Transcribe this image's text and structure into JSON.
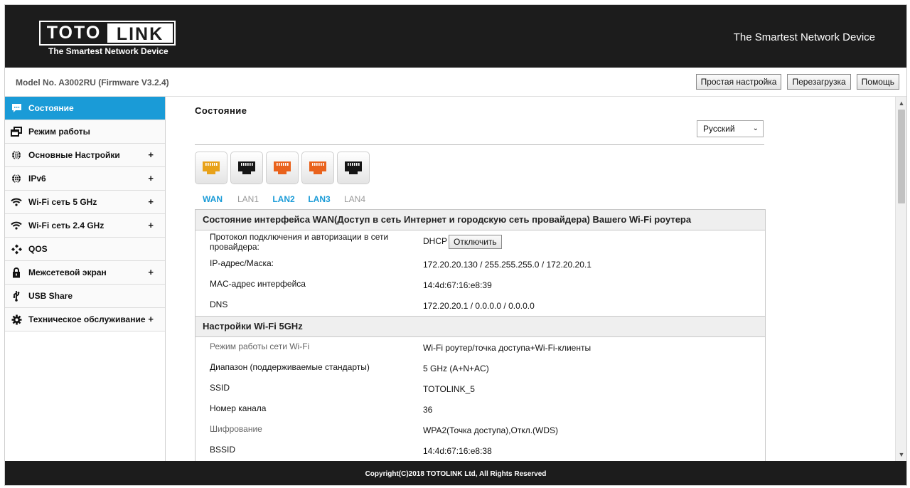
{
  "header": {
    "logo_left": "TOTO",
    "logo_right": "LINK",
    "logo_tagline": "The Smartest Network Device",
    "slogan": "The Smartest Network Device"
  },
  "subbar": {
    "model": "Model No. A3002RU (Firmware V3.2.4)",
    "buttons": [
      "Простая настройка",
      "Перезагрузка",
      "Помощь"
    ]
  },
  "sidebar": {
    "items": [
      {
        "label": "Состояние",
        "icon": "chat-icon",
        "expandable": false,
        "active": true
      },
      {
        "label": "Режим работы",
        "icon": "windows-icon",
        "expandable": false,
        "active": false
      },
      {
        "label": "Основные Настройки",
        "icon": "globe-icon",
        "expandable": true,
        "active": false
      },
      {
        "label": "IPv6",
        "icon": "globe-icon",
        "expandable": true,
        "active": false
      },
      {
        "label": "Wi-Fi сеть 5 GHz",
        "icon": "wifi-icon",
        "expandable": true,
        "active": false
      },
      {
        "label": "Wi-Fi сеть 2.4 GHz",
        "icon": "wifi-icon",
        "expandable": true,
        "active": false
      },
      {
        "label": "QOS",
        "icon": "diamonds-icon",
        "expandable": false,
        "active": false
      },
      {
        "label": "Межсетевой экран",
        "icon": "lock-icon",
        "expandable": true,
        "active": false
      },
      {
        "label": "USB Share",
        "icon": "usb-icon",
        "expandable": false,
        "active": false
      },
      {
        "label": "Техническое обслуживание",
        "icon": "gear-icon",
        "expandable": true,
        "active": false
      }
    ],
    "plus": "+"
  },
  "main": {
    "title": "Состояние",
    "language": "Русский",
    "ports": [
      {
        "label": "WAN",
        "state": "active",
        "color": "#e8a21a",
        "label_color": "#1a9bd7"
      },
      {
        "label": "LAN1",
        "state": "inactive",
        "color": "#151515",
        "label_color": "#9a9a9a"
      },
      {
        "label": "LAN2",
        "state": "active",
        "color": "#e9621c",
        "label_color": "#1a9bd7"
      },
      {
        "label": "LAN3",
        "state": "active",
        "color": "#e9621c",
        "label_color": "#1a9bd7"
      },
      {
        "label": "LAN4",
        "state": "inactive",
        "color": "#151515",
        "label_color": "#9a9a9a"
      }
    ],
    "wan_section": {
      "title": "Состояние интерфейса WAN(Доступ в сеть Интернет и городскую сеть провайдера) Вашего Wi-Fi роутера",
      "protocol_label": "Протокол подключения и авторизации в сети провайдера:",
      "protocol_value": "DHCP",
      "disconnect_button": "Отключить",
      "ip_label": "IP-адрес/Маска:",
      "ip_value": "172.20.20.130 / 255.255.255.0 / 172.20.20.1",
      "mac_label": "MAC-адрес интерфейса",
      "mac_value": "14:4d:67:16:e8:39",
      "dns_label": "DNS",
      "dns_value": "172.20.20.1 / 0.0.0.0 / 0.0.0.0"
    },
    "wifi_section": {
      "title": "Настройки Wi-Fi 5GHz",
      "mode_label": "Режим работы сети Wi-Fi",
      "mode_value": "Wi-Fi роутер/точка доступа+Wi-Fi-клиенты",
      "band_label": "Диапазон (поддерживаемые стандарты)",
      "band_value": "5 GHz (A+N+AC)",
      "ssid_label": "SSID",
      "ssid_value": "TOTOLINK_5",
      "channel_label": "Номер канала",
      "channel_value": "36",
      "enc_label": "Шифрование",
      "enc_value": "WPA2(Точка доступа),Откл.(WDS)",
      "bssid_label": "BSSID",
      "bssid_value": "14:4d:67:16:e8:38"
    }
  },
  "footer": {
    "copyright": "Copyright(C)2018 TOTOLINK Ltd, All Rights Reserved"
  }
}
